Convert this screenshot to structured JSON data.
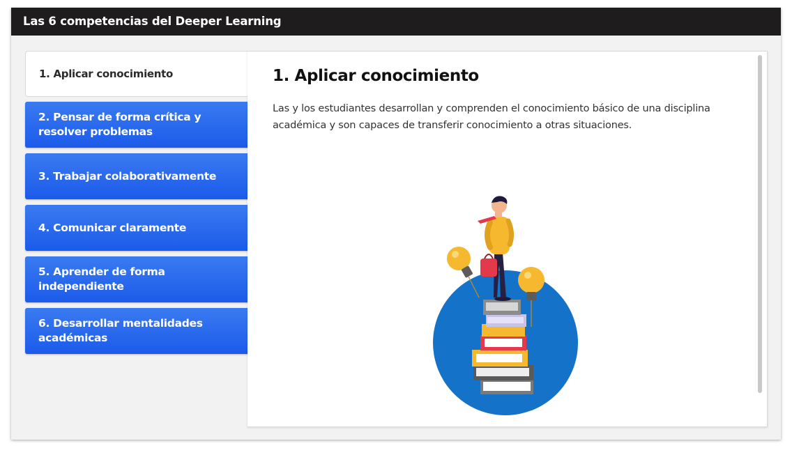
{
  "header": {
    "title": "Las 6 competencias del Deeper Learning"
  },
  "tabs": [
    {
      "label": "1. Aplicar conocimiento",
      "active": true
    },
    {
      "label": "2. Pensar de forma crítica y resolver problemas",
      "active": false
    },
    {
      "label": "3. Trabajar colaborativamente",
      "active": false
    },
    {
      "label": "4. Comunicar claramente",
      "active": false
    },
    {
      "label": "5. Aprender de forma independiente",
      "active": false
    },
    {
      "label": "6. Desarrollar mentalidades académicas",
      "active": false
    }
  ],
  "content": {
    "title": "1. Aplicar conocimiento",
    "body": "Las y los estudiantes desarrollan y comprenden el conocimiento básico de una disciplina académica y son capaces de transferir conocimiento a otras situaciones."
  },
  "colors": {
    "titlebar": "#1f1c1d",
    "tab_active_bg": "#ffffff",
    "tab_inactive_bg": "#2563eb",
    "circle": "#1572c9",
    "bulb": "#f5b82e"
  },
  "icons": [
    "student-on-books-illustration",
    "lightbulb-icon"
  ]
}
